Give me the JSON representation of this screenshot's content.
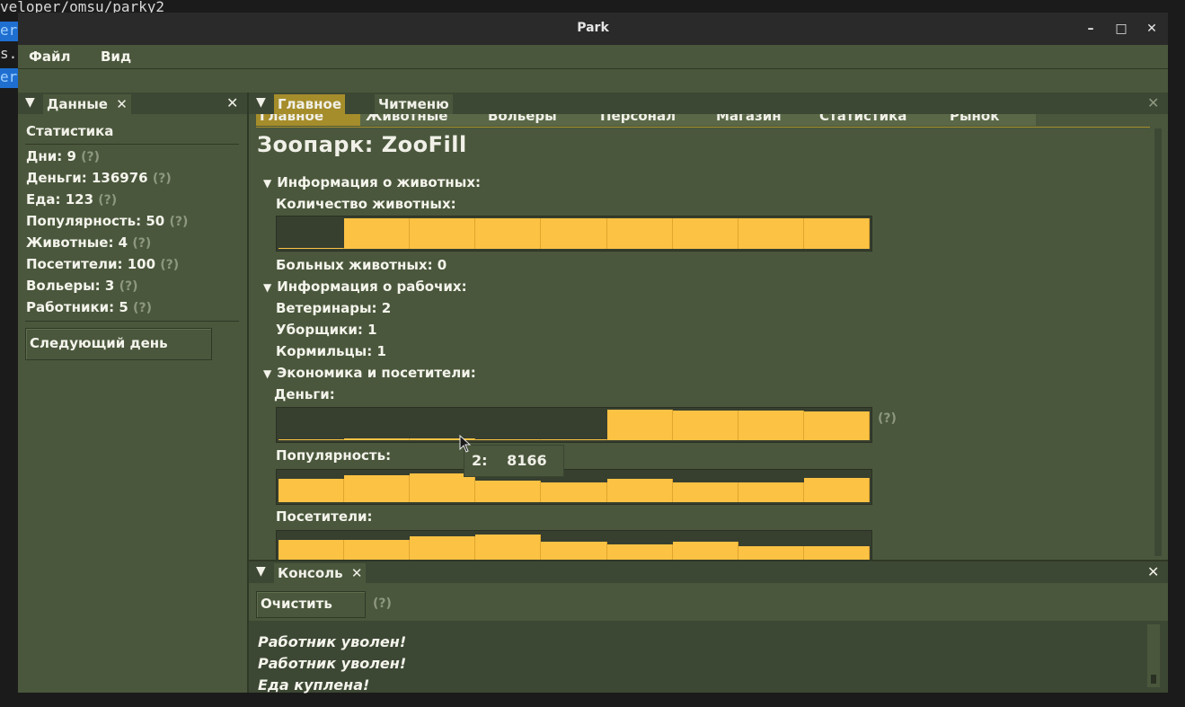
{
  "terminal": {
    "line1": "veloper/omsu/parky2",
    "hl1": "er",
    "line2": "s.",
    "hl2": "er"
  },
  "window": {
    "title": "Park",
    "minimize": "–",
    "maximize": "□",
    "close": "✕"
  },
  "menu": {
    "file": "Файл",
    "view": "Вид"
  },
  "left_panel": {
    "tab": "Данные",
    "section": "Статистика",
    "stats": [
      {
        "label": "Дни: 9",
        "help": "(?)"
      },
      {
        "label": "Деньги: 136976",
        "help": "(?)"
      },
      {
        "label": "Еда: 123",
        "help": "(?)"
      },
      {
        "label": "Популярность: 50",
        "help": "(?)"
      },
      {
        "label": "Животные: 4",
        "help": "(?)"
      },
      {
        "label": "Посетители: 100",
        "help": "(?)"
      },
      {
        "label": "Вольеры: 3",
        "help": "(?)"
      },
      {
        "label": "Работники: 5",
        "help": "(?)"
      }
    ],
    "next_day": "Следующий день"
  },
  "main_panel": {
    "tabs": [
      "Главное",
      "Читменю"
    ],
    "subtabs": [
      "Главное",
      "Животные",
      "Вольеры",
      "Персонал",
      "Магазин",
      "Статистика",
      "Рынок"
    ],
    "zoo_title": "Зоопарк: ZooFill",
    "animals_header": "Информация о животных:",
    "animal_count_label": "Количество животных:",
    "sick_label": "Больных животных: 0",
    "workers_header": "Информация о рабочих:",
    "vets": "Ветеринары: 2",
    "cleaners": "Уборщики: 1",
    "feeders": "Кормильцы: 1",
    "economy_header": "Экономика и посетители:",
    "money_label": "Деньги:",
    "money_help": "(?)",
    "popularity_label": "Популярность:",
    "visitors_label": "Посетители:",
    "tooltip_index": "2:",
    "tooltip_value": "8166"
  },
  "charts": {
    "animals": [
      0,
      1,
      1,
      1,
      1,
      1,
      1,
      1,
      1
    ],
    "money": [
      0.04,
      0.06,
      0.05,
      0.02,
      0.0,
      1.0,
      0.97,
      0.97,
      0.93
    ],
    "popularity": [
      0.75,
      0.88,
      0.95,
      0.7,
      0.65,
      0.76,
      0.65,
      0.65,
      0.78
    ],
    "visitors": [
      0.75,
      0.75,
      0.88,
      0.95,
      0.7,
      0.62,
      0.7,
      0.56,
      0.56
    ]
  },
  "console": {
    "tab": "Консоль",
    "clear": "Очистить",
    "help": "(?)",
    "lines": [
      "Работник уволен!",
      "Работник уволен!",
      "Еда куплена!"
    ]
  },
  "colors": {
    "bar": "#fcc244",
    "panel": "#4a573c",
    "tab_active": "#a68d2b"
  }
}
